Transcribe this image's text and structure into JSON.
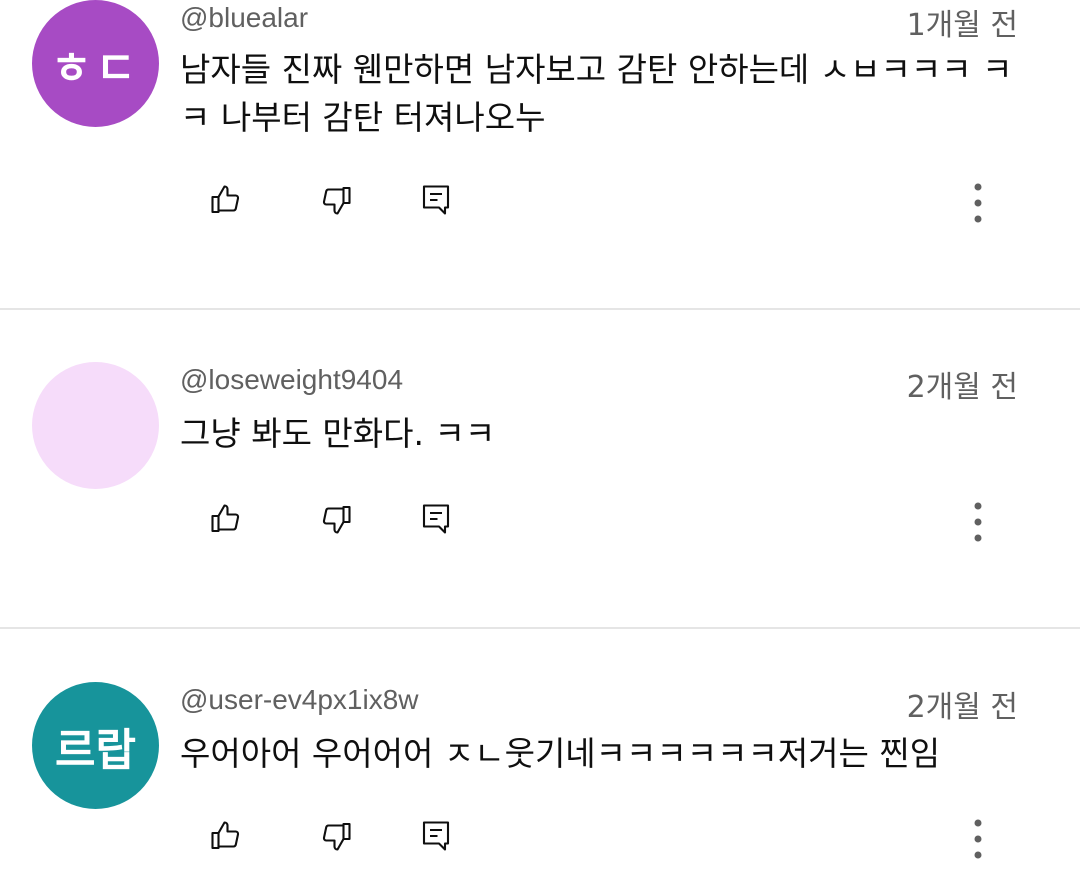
{
  "comments": [
    {
      "handle": "@bluealar",
      "time": "1개월 전",
      "avatar_text": "ㅎㄷ",
      "avatar_color": "#a74bc4",
      "text": "남자들 진짜 웬만하면 남자보고 감탄 안하는데 ㅅㅂㅋㅋㅋ ㅋㅋ 나부터 감탄 터져나오누"
    },
    {
      "handle": "@loseweight9404",
      "time": "2개월 전",
      "avatar_text": "",
      "avatar_color": "#f6dcfa",
      "text": "그냥 봐도 만화다. ㅋㅋ"
    },
    {
      "handle": "@user-ev4px1ix8w",
      "time": "2개월 전",
      "avatar_text": "르랍",
      "avatar_color": "#17949b",
      "text": "우어아어 우어어어 ㅈㄴ웃기네ㅋㅋㅋㅋㅋㅋ저거는 찐임"
    }
  ],
  "icons": {
    "like": "thumbs-up-icon",
    "dislike": "thumbs-down-icon",
    "reply": "reply-icon",
    "more": "more-vertical-icon"
  }
}
